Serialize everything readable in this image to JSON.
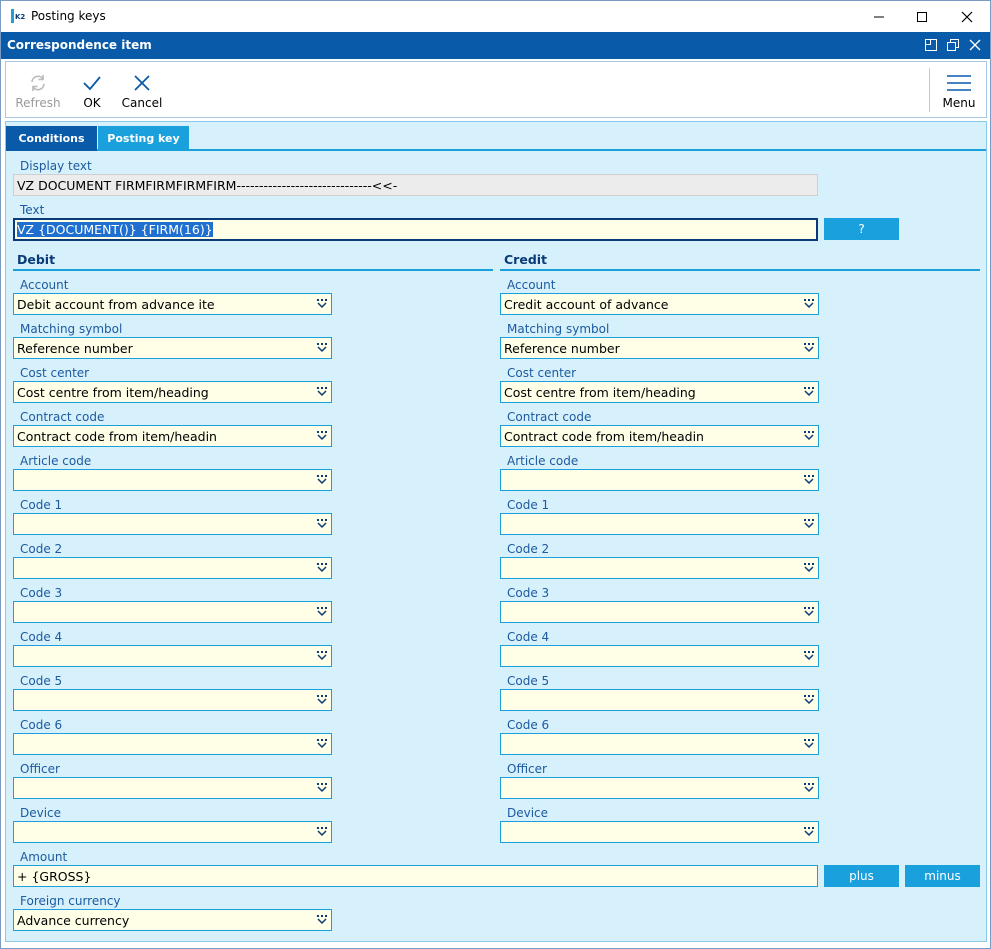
{
  "window": {
    "title": "Posting keys"
  },
  "header": {
    "title": "Correspondence item"
  },
  "toolbar": {
    "refresh": "Refresh",
    "ok": "OK",
    "cancel": "Cancel",
    "menu": "Menu"
  },
  "tabs": {
    "conditions": "Conditions",
    "posting_key": "Posting key"
  },
  "display_text": {
    "label": "Display text",
    "value": "VZ DOCUMENT FIRMFIRMFIRMFIRM------------------------------<<-"
  },
  "text": {
    "label": "Text",
    "value": "VZ {DOCUMENT()} {FIRM(16)}",
    "help_button": "?"
  },
  "debit": {
    "title": "Debit",
    "fields": [
      {
        "label": "Account",
        "value": "Debit account from advance ite"
      },
      {
        "label": "Matching symbol",
        "value": "Reference number"
      },
      {
        "label": "Cost center",
        "value": "Cost centre from item/heading"
      },
      {
        "label": "Contract code",
        "value": "Contract code from item/headin"
      },
      {
        "label": "Article code",
        "value": ""
      },
      {
        "label": "Code 1",
        "value": ""
      },
      {
        "label": "Code 2",
        "value": ""
      },
      {
        "label": "Code 3",
        "value": ""
      },
      {
        "label": "Code 4",
        "value": ""
      },
      {
        "label": "Code 5",
        "value": ""
      },
      {
        "label": "Code 6",
        "value": ""
      },
      {
        "label": "Officer",
        "value": ""
      },
      {
        "label": "Device",
        "value": ""
      }
    ]
  },
  "credit": {
    "title": "Credit",
    "fields": [
      {
        "label": "Account",
        "value": "Credit account of advance"
      },
      {
        "label": "Matching symbol",
        "value": "Reference number"
      },
      {
        "label": "Cost center",
        "value": "Cost centre from item/heading"
      },
      {
        "label": "Contract code",
        "value": "Contract code from item/headin"
      },
      {
        "label": "Article code",
        "value": ""
      },
      {
        "label": "Code 1",
        "value": ""
      },
      {
        "label": "Code 2",
        "value": ""
      },
      {
        "label": "Code 3",
        "value": ""
      },
      {
        "label": "Code 4",
        "value": ""
      },
      {
        "label": "Code 5",
        "value": ""
      },
      {
        "label": "Code 6",
        "value": ""
      },
      {
        "label": "Officer",
        "value": ""
      },
      {
        "label": "Device",
        "value": ""
      }
    ]
  },
  "amount": {
    "label": "Amount",
    "value": "+ {GROSS}",
    "plus": "plus",
    "minus": "minus"
  },
  "foreign_currency": {
    "label": "Foreign currency",
    "value": "Advance currency"
  },
  "colors": {
    "header": "#0a5aaa",
    "accent": "#1aa0dc",
    "panel": "#d6f1fc",
    "field": "#fffee6"
  }
}
